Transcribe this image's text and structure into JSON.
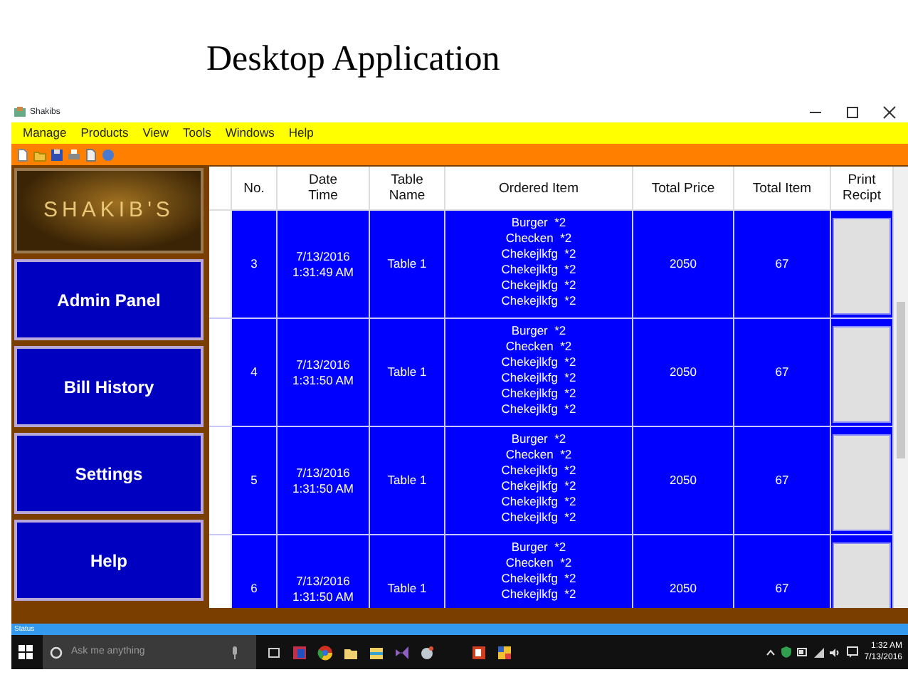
{
  "slide_title": "Desktop Application",
  "window": {
    "title": "Shakibs"
  },
  "menu": [
    "Manage",
    "Products",
    "View",
    "Tools",
    "Windows",
    "Help"
  ],
  "sidebar": {
    "logo": "SHAKIB'S",
    "buttons": [
      "Admin Panel",
      "Bill History",
      "Settings",
      "Help"
    ]
  },
  "table": {
    "columns": [
      "No.",
      "Date\nTime",
      "Table\nName",
      "Ordered Item",
      "Total Price",
      "Total Item",
      "Print\nRecipt"
    ],
    "rows": [
      {
        "selected": true,
        "no": "3",
        "date_time": "7/13/2016\n1:31:49 AM",
        "table_name": "Table 1",
        "ordered_items": [
          "Burger  *2",
          "Checken  *2",
          "Chekejlkfg  *2",
          "Chekejlkfg  *2",
          "Chekejlkfg  *2",
          "Chekejlkfg  *2"
        ],
        "total_price": "2050",
        "total_item": "67"
      },
      {
        "selected": true,
        "no": "4",
        "date_time": "7/13/2016\n1:31:50 AM",
        "table_name": "Table 1",
        "ordered_items": [
          "Burger  *2",
          "Checken  *2",
          "Chekejlkfg  *2",
          "Chekejlkfg  *2",
          "Chekejlkfg  *2",
          "Chekejlkfg  *2"
        ],
        "total_price": "2050",
        "total_item": "67"
      },
      {
        "selected": true,
        "no": "5",
        "date_time": "7/13/2016\n1:31:50 AM",
        "table_name": "Table 1",
        "ordered_items": [
          "Burger  *2",
          "Checken  *2",
          "Chekejlkfg  *2",
          "Chekejlkfg  *2",
          "Chekejlkfg  *2",
          "Chekejlkfg  *2"
        ],
        "total_price": "2050",
        "total_item": "67"
      },
      {
        "selected": true,
        "no": "6",
        "date_time": "7/13/2016\n1:31:50 AM",
        "table_name": "Table 1",
        "ordered_items": [
          "Burger  *2",
          "Checken  *2",
          "Chekejlkfg  *2",
          "Chekejlkfg  *2"
        ],
        "total_price": "2050",
        "total_item": "67"
      }
    ]
  },
  "status_bar": "Status",
  "taskbar": {
    "search_placeholder": "Ask me anything",
    "time": "1:32 AM",
    "date": "7/13/2016"
  }
}
